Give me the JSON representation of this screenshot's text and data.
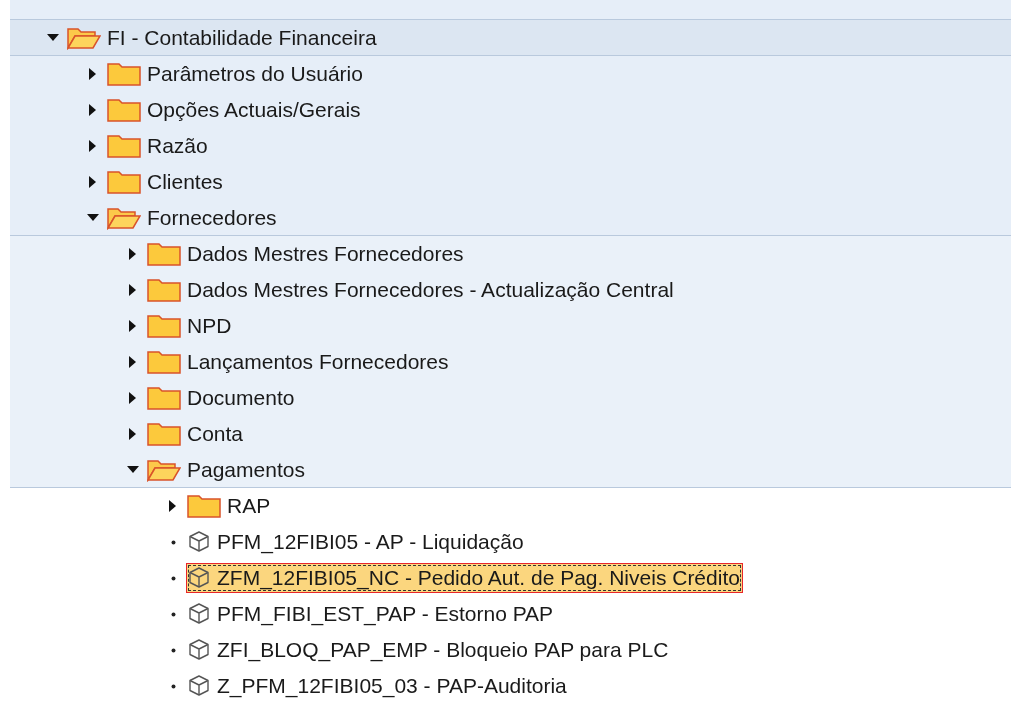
{
  "tree": [
    {
      "kind": "folder",
      "label": "FI - Contabilidade Financeira",
      "expanded": true,
      "selected": false,
      "children": [
        {
          "kind": "folder",
          "label": "Parâmetros do Usuário",
          "expanded": false,
          "selected": false
        },
        {
          "kind": "folder",
          "label": "Opções Actuais/Gerais",
          "expanded": false,
          "selected": false
        },
        {
          "kind": "folder",
          "label": "Razão",
          "expanded": false,
          "selected": false
        },
        {
          "kind": "folder",
          "label": "Clientes",
          "expanded": false,
          "selected": false
        },
        {
          "kind": "folder",
          "label": "Fornecedores",
          "expanded": true,
          "selected": false,
          "children": [
            {
              "kind": "folder",
              "label": "Dados Mestres Fornecedores",
              "expanded": false,
              "selected": false
            },
            {
              "kind": "folder",
              "label": "Dados Mestres Fornecedores - Actualização Central",
              "expanded": false,
              "selected": false
            },
            {
              "kind": "folder",
              "label": "NPD",
              "expanded": false,
              "selected": false
            },
            {
              "kind": "folder",
              "label": "Lançamentos Fornecedores",
              "expanded": false,
              "selected": false
            },
            {
              "kind": "folder",
              "label": "Documento",
              "expanded": false,
              "selected": false
            },
            {
              "kind": "folder",
              "label": "Conta",
              "expanded": false,
              "selected": false
            },
            {
              "kind": "folder",
              "label": "Pagamentos",
              "expanded": true,
              "selected": false,
              "children": [
                {
                  "kind": "folder",
                  "label": "RAP",
                  "expanded": false,
                  "selected": false
                },
                {
                  "kind": "transaction",
                  "label": "PFM_12FIBI05 - AP - Liquidação",
                  "selected": false
                },
                {
                  "kind": "transaction",
                  "label": "ZFM_12FIBI05_NC - Pedido Aut. de Pag. Niveis Crédito",
                  "selected": true
                },
                {
                  "kind": "transaction",
                  "label": "PFM_FIBI_EST_PAP - Estorno PAP",
                  "selected": false
                },
                {
                  "kind": "transaction",
                  "label": "ZFI_BLOQ_PAP_EMP - Bloqueio PAP para PLC",
                  "selected": false
                },
                {
                  "kind": "transaction",
                  "label": "Z_PFM_12FIBI05_03 - PAP-Auditoria",
                  "selected": false
                }
              ]
            }
          ]
        }
      ]
    }
  ]
}
